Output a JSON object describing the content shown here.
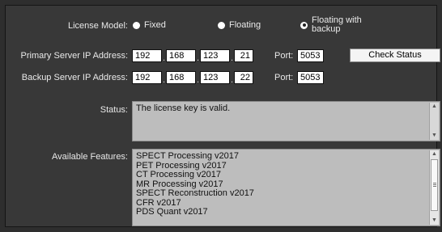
{
  "license": {
    "label": "License Model:",
    "options": [
      {
        "label": "Fixed",
        "selected": false
      },
      {
        "label": "Floating",
        "selected": false
      },
      {
        "label": "Floating with backup",
        "line1": "Floating with",
        "line2": "backup",
        "selected": true
      }
    ]
  },
  "primary": {
    "label": "Primary Server IP Address:",
    "ip": [
      "192",
      "168",
      "123",
      "21"
    ],
    "port_label": "Port:",
    "port": "5053"
  },
  "backup": {
    "label": "Backup Server IP Address:",
    "ip": [
      "192",
      "168",
      "123",
      "22"
    ],
    "port_label": "Port:",
    "port": "5053"
  },
  "check_status_label": "Check Status",
  "status": {
    "label": "Status:",
    "text": "The license key is valid."
  },
  "features": {
    "label": "Available Features:",
    "items": [
      "SPECT Processing v2017",
      "PET Processing v2017",
      "CT Processing v2017",
      "MR Processing v2017",
      "SPECT Reconstruction v2017",
      "CFR v2017",
      "PDS Quant v2017"
    ]
  },
  "ip_separator": ".",
  "icons": {
    "scroll_up": "arrow-up-icon",
    "scroll_down": "arrow-down-icon",
    "radio": "radio-icon"
  },
  "colors": {
    "background": "#383838",
    "text_area": "#bdbdbd",
    "input": "#ffffff"
  }
}
